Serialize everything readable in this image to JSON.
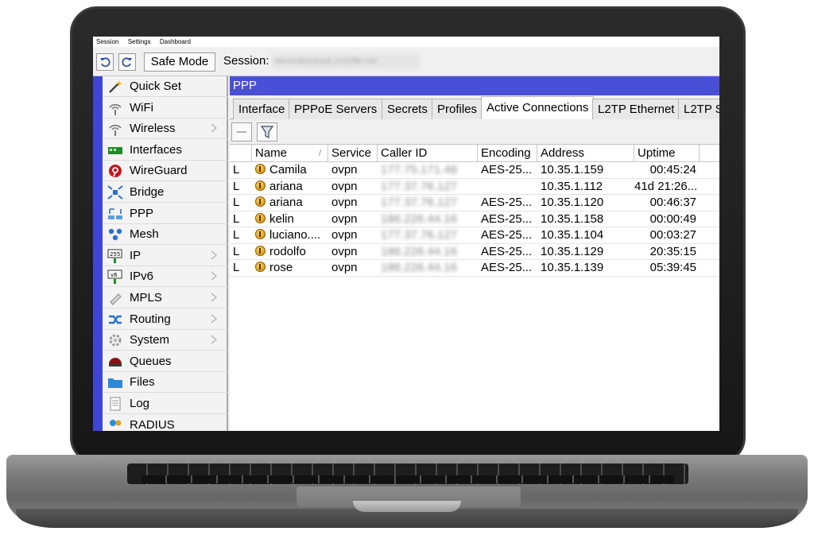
{
  "menu": [
    "Session",
    "Settings",
    "Dashboard"
  ],
  "toolbar": {
    "safe_mode_label": "Safe Mode",
    "session_label": "Session:",
    "session_value": "s0nomb1cloud.1n1nfle.net"
  },
  "sidebar": {
    "items": [
      {
        "label": "Quick Set",
        "icon": "wand-icon",
        "submenu": false
      },
      {
        "label": "WiFi",
        "icon": "wifi-icon",
        "submenu": false
      },
      {
        "label": "Wireless",
        "icon": "wireless-icon",
        "submenu": true
      },
      {
        "label": "Interfaces",
        "icon": "interfaces-icon",
        "submenu": false
      },
      {
        "label": "WireGuard",
        "icon": "wireguard-icon",
        "submenu": false
      },
      {
        "label": "Bridge",
        "icon": "bridge-icon",
        "submenu": false
      },
      {
        "label": "PPP",
        "icon": "ppp-icon",
        "submenu": false
      },
      {
        "label": "Mesh",
        "icon": "mesh-icon",
        "submenu": false
      },
      {
        "label": "IP",
        "icon": "ip-icon",
        "submenu": true
      },
      {
        "label": "IPv6",
        "icon": "ipv6-icon",
        "submenu": true
      },
      {
        "label": "MPLS",
        "icon": "mpls-icon",
        "submenu": true
      },
      {
        "label": "Routing",
        "icon": "routing-icon",
        "submenu": true
      },
      {
        "label": "System",
        "icon": "system-icon",
        "submenu": true
      },
      {
        "label": "Queues",
        "icon": "queues-icon",
        "submenu": false
      },
      {
        "label": "Files",
        "icon": "files-icon",
        "submenu": false
      },
      {
        "label": "Log",
        "icon": "log-icon",
        "submenu": false
      },
      {
        "label": "RADIUS",
        "icon": "radius-icon",
        "submenu": false
      }
    ]
  },
  "window": {
    "title": "PPP",
    "tabs": [
      "Interface",
      "PPPoE Servers",
      "Secrets",
      "Profiles",
      "Active Connections",
      "L2TP Ethernet",
      "L2TP S"
    ],
    "active_tab": "Active Connections"
  },
  "table": {
    "columns": [
      "Name",
      "Service",
      "Caller ID",
      "Encoding",
      "Address",
      "Uptime"
    ],
    "rows": [
      {
        "flag": "L",
        "name": "Camila",
        "service": "ovpn",
        "caller_id": "177.75.171.48",
        "encoding": "AES-25...",
        "address": "10.35.1.159",
        "uptime": "00:45:24"
      },
      {
        "flag": "L",
        "name": "ariana",
        "service": "ovpn",
        "caller_id": "177.37.76.127",
        "encoding": "",
        "address": "10.35.1.112",
        "uptime": "41d 21:26..."
      },
      {
        "flag": "L",
        "name": "ariana",
        "service": "ovpn",
        "caller_id": "177.37.76.127",
        "encoding": "AES-25...",
        "address": "10.35.1.120",
        "uptime": "00:46:37"
      },
      {
        "flag": "L",
        "name": "kelin",
        "service": "ovpn",
        "caller_id": "186.226.44.16",
        "encoding": "AES-25...",
        "address": "10.35.1.158",
        "uptime": "00:00:49"
      },
      {
        "flag": "L",
        "name": "luciano....",
        "service": "ovpn",
        "caller_id": "177.37.76.127",
        "encoding": "AES-25...",
        "address": "10.35.1.104",
        "uptime": "00:03:27"
      },
      {
        "flag": "L",
        "name": "rodolfo",
        "service": "ovpn",
        "caller_id": "186.226.44.16",
        "encoding": "AES-25...",
        "address": "10.35.1.129",
        "uptime": "20:35:15"
      },
      {
        "flag": "L",
        "name": "rose",
        "service": "ovpn",
        "caller_id": "186.226.44.16",
        "encoding": "AES-25...",
        "address": "10.35.1.139",
        "uptime": "05:39:45"
      }
    ]
  },
  "colors": {
    "accent": "#4a4fd8",
    "strip": "#3d46d4"
  }
}
